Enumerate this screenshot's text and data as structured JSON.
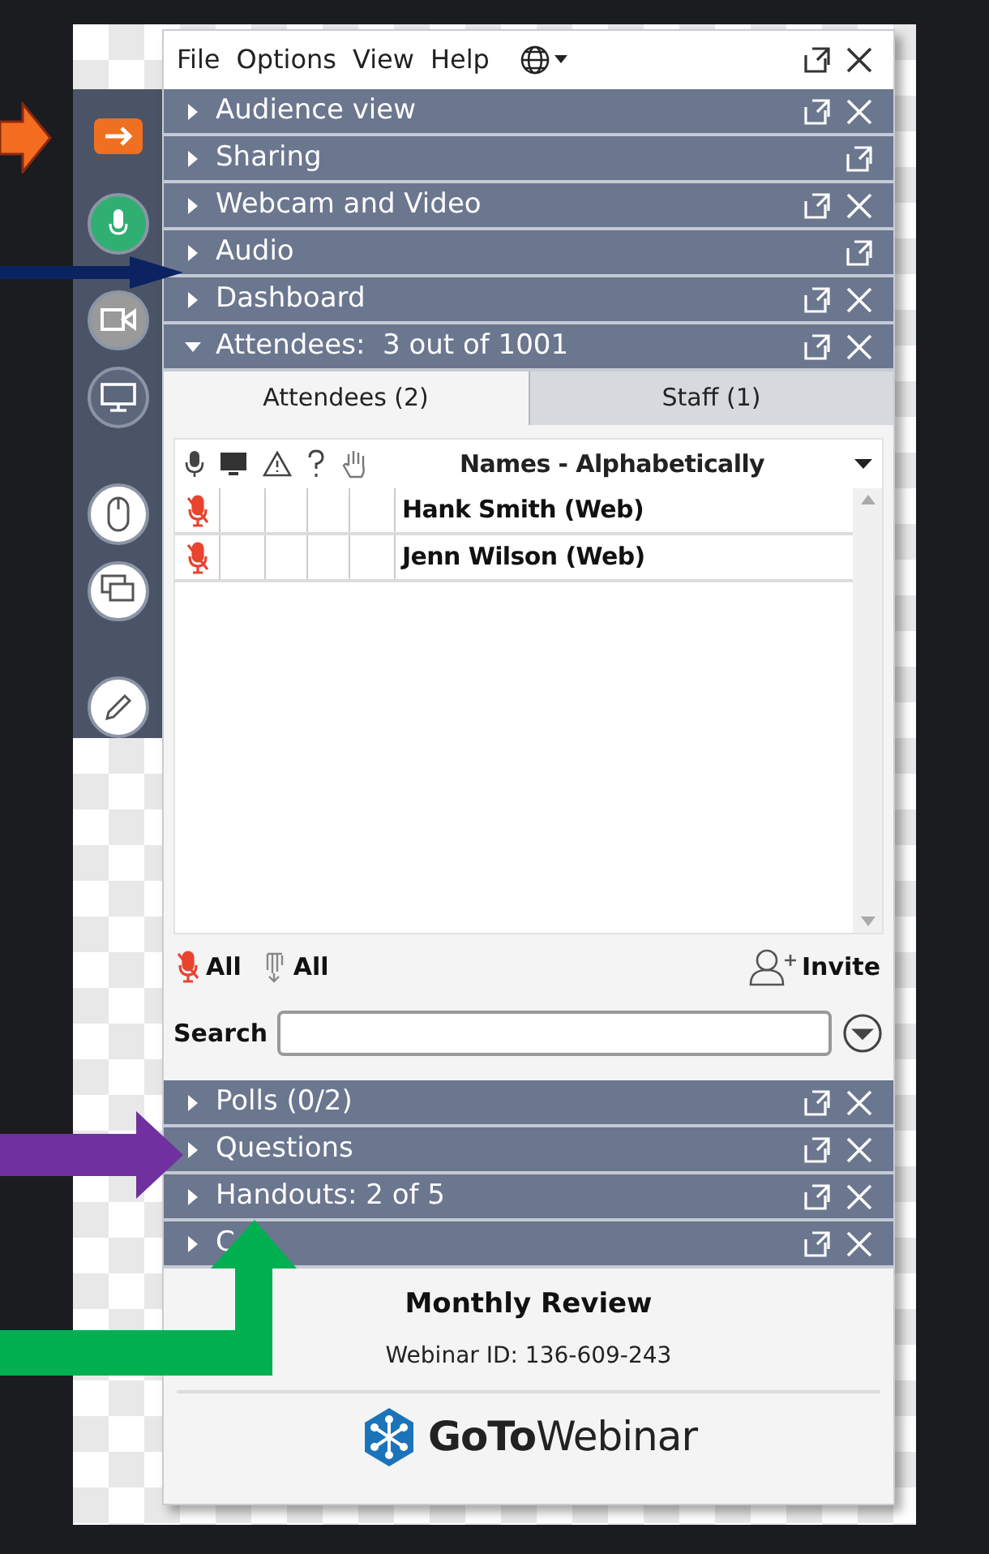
{
  "menu": {
    "items": [
      "File",
      "Options",
      "View",
      "Help"
    ]
  },
  "panels_top": [
    {
      "title": "Audience view",
      "expanded": false,
      "closable": true
    },
    {
      "title": "Sharing",
      "expanded": false,
      "closable": false
    },
    {
      "title": "Webcam and Video",
      "expanded": false,
      "closable": true
    },
    {
      "title": "Audio",
      "expanded": false,
      "closable": false
    },
    {
      "title": "Dashboard",
      "expanded": false,
      "closable": true
    },
    {
      "title": "Attendees:  3 out of 1001",
      "expanded": true,
      "closable": true
    }
  ],
  "attendees": {
    "tabs": [
      {
        "label": "Attendees (2)",
        "selected": true
      },
      {
        "label": "Staff (1)",
        "selected": false
      }
    ],
    "sort": "Names - Alphabetically",
    "rows": [
      {
        "name": "Hank Smith (Web)",
        "muted": true
      },
      {
        "name": "Jenn Wilson (Web)",
        "muted": true
      }
    ],
    "mute_all": "All",
    "lower_hands": "All",
    "invite": "Invite",
    "search_label": "Search"
  },
  "panels_bottom": [
    {
      "title": "Polls (0/2)",
      "expanded": false,
      "closable": true
    },
    {
      "title": "Questions",
      "expanded": false,
      "closable": true
    },
    {
      "title": "Handouts: 2 of 5",
      "expanded": false,
      "closable": true
    },
    {
      "title": "C",
      "expanded": false,
      "closable": true
    }
  ],
  "footer": {
    "title": "Monthly Review",
    "webinar_id": "Webinar ID: 136-609-243",
    "logo": "**GoTo**Webinar"
  }
}
